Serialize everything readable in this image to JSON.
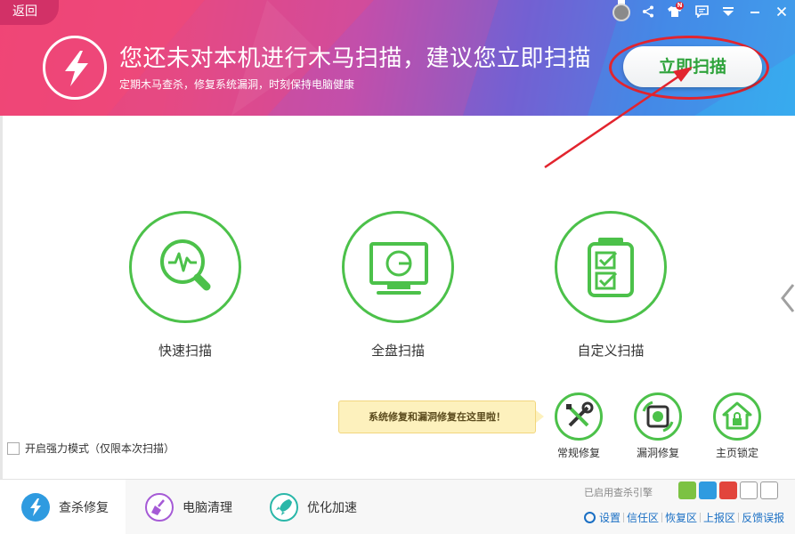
{
  "header": {
    "back_label": "返回",
    "headline": "您还未对本机进行木马扫描，建议您立即扫描",
    "subline": "定期木马查杀，修复系统漏洞，时刻保持电脑健康",
    "scan_now_label": "立即扫描",
    "notification_badge": "N"
  },
  "scan_options": [
    {
      "label": "快速扫描",
      "icon": "quick-scan-icon"
    },
    {
      "label": "全盘扫描",
      "icon": "monitor-icon"
    },
    {
      "label": "自定义扫描",
      "icon": "checklist-icon"
    }
  ],
  "tooltip": {
    "text": "系统修复和漏洞修复在这里啦！"
  },
  "tools": [
    {
      "label": "常规修复",
      "icon": "wrench-screwdriver-icon"
    },
    {
      "label": "漏洞修复",
      "icon": "patch-icon"
    },
    {
      "label": "主页锁定",
      "icon": "home-lock-icon"
    }
  ],
  "strong_mode": {
    "label": "开启强力模式（仅限本次扫描）"
  },
  "footer": {
    "tabs": [
      {
        "label": "查杀修复",
        "icon": "bolt-icon",
        "active": true
      },
      {
        "label": "电脑清理",
        "icon": "broom-icon",
        "active": false
      },
      {
        "label": "优化加速",
        "icon": "rocket-icon",
        "active": false
      }
    ],
    "powered_text": "已启用查杀引擎",
    "links": [
      "设置",
      "信任区",
      "恢复区",
      "上报区",
      "反馈误报"
    ]
  },
  "colors": {
    "accent_green": "#4cc14a",
    "scan_button_text": "#2ea33b",
    "highlight_red": "#e2242e",
    "link_blue": "#1a6fc4"
  }
}
